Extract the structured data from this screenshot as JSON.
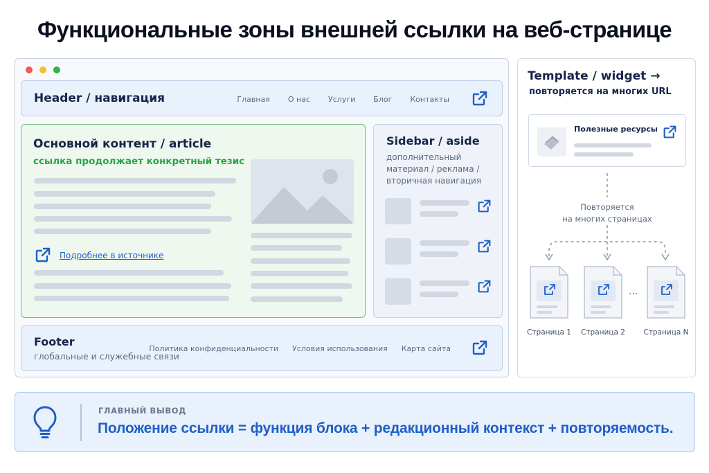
{
  "title": "Функциональные зоны внешней ссылки на веб-странице",
  "colors": {
    "accent_blue": "#1f5fc7",
    "accent_green": "#2ca24a",
    "zone_blue_bg": "#e9f1fc",
    "zone_green_bg": "#eef8ee"
  },
  "browser": {
    "header": {
      "title": "Header / навигация",
      "nav": [
        "Главная",
        "О нас",
        "Услуги",
        "Блог",
        "Контакты"
      ],
      "icon": "external-link-icon"
    },
    "main": {
      "title": "Основной контент / article",
      "subtitle": "ссылка продолжает конкретный тезис",
      "link_text": "Подробнее в источнике",
      "icon": "external-link-icon"
    },
    "sidebar": {
      "title": "Sidebar / aside",
      "description": "дополнительный материал / реклама / вторичная навигация",
      "icon": "external-link-icon"
    },
    "footer": {
      "title": "Footer",
      "subtitle": "глобальные и служебные связи",
      "links": [
        "Политика конфиденциальности",
        "Условия использования",
        "Карта сайта"
      ],
      "icon": "external-link-icon"
    }
  },
  "template": {
    "title": "Template / widget →",
    "subtitle": "повторяется на многих URL",
    "widget_title": "Полезные ресурсы",
    "repeat_label_1": "Повторяется",
    "repeat_label_2": "на многих страницах",
    "pages": [
      "Страница 1",
      "Страница 2",
      "Страница N"
    ],
    "ellipsis": "..."
  },
  "conclusion": {
    "label": "ГЛАВНЫЙ ВЫВОД",
    "text": "Положение ссылки = функция блока + редакционный контекст + повторяемость.",
    "icon": "lightbulb-icon"
  }
}
